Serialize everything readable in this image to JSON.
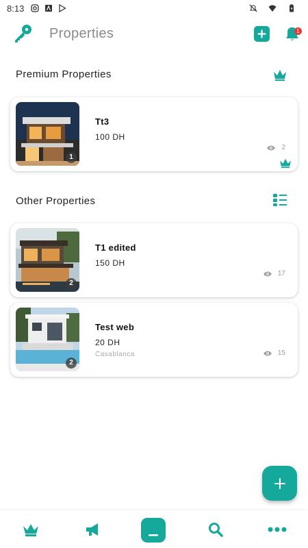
{
  "status_bar": {
    "time": "8:13",
    "left_icons": [
      "instagram-icon",
      "a-app-icon",
      "play-store-icon"
    ],
    "right_icons": [
      "mute-icon",
      "wifi-icon",
      "battery-icon"
    ]
  },
  "app_bar": {
    "title": "Properties",
    "logo_icon": "key-icon",
    "add_icon": "plus-square-icon",
    "notifications_icon": "bell-icon",
    "notification_count": "1"
  },
  "colors": {
    "accent": "#14a99a",
    "badge": "#e53935"
  },
  "premium_section": {
    "title": "Premium Properties",
    "icon": "crown-icon",
    "items": [
      {
        "title": "Tt3",
        "price": "100 DH",
        "city": "",
        "views": "2",
        "image_count": "1",
        "premium_icon": "crown-icon"
      }
    ]
  },
  "other_section": {
    "title": "Other Properties",
    "icon": "list-view-icon",
    "items": [
      {
        "title": "T1 edited",
        "price": "150 DH",
        "city": "",
        "views": "17",
        "image_count": "2"
      },
      {
        "title": "Test web",
        "price": "20 DH",
        "city": "Casablanca",
        "views": "15",
        "image_count": "2"
      }
    ]
  },
  "fab": {
    "icon": "plus-icon"
  },
  "bottom_nav": {
    "items": [
      "crown-icon",
      "megaphone-icon",
      "home-icon",
      "search-icon",
      "more-icon"
    ],
    "active": "home-icon"
  }
}
